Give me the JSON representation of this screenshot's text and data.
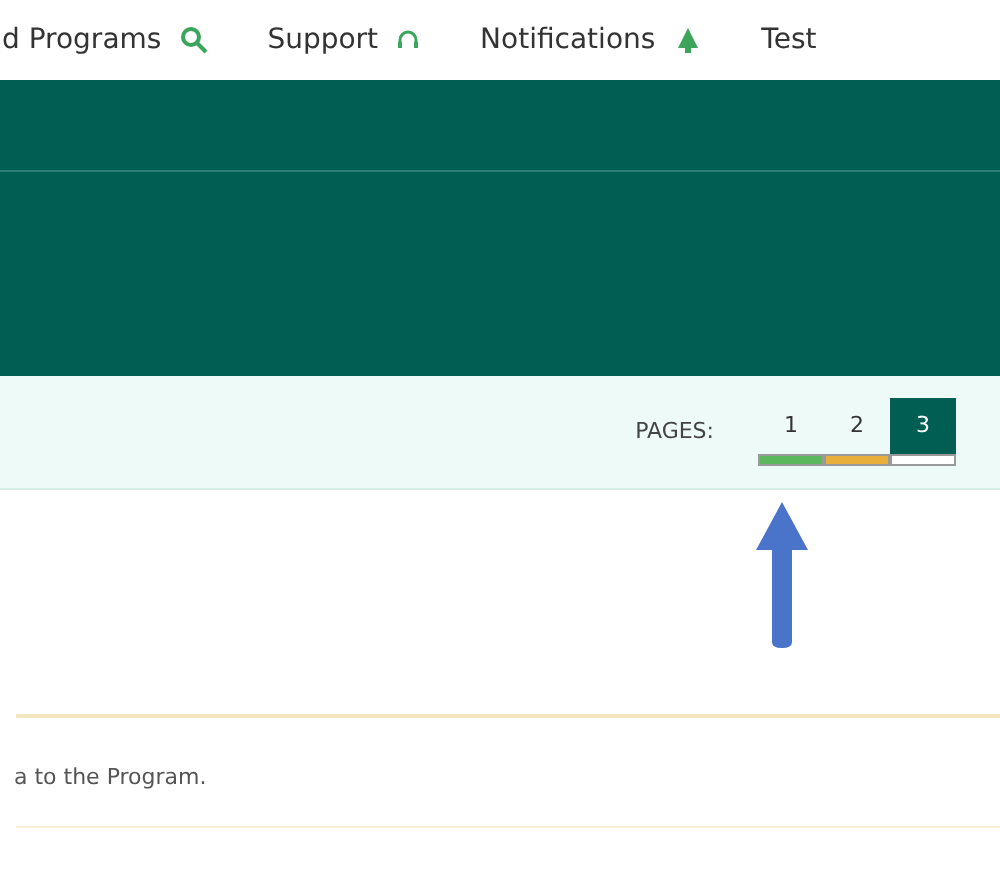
{
  "nav": [
    {
      "label": "d Programs",
      "kind": "search"
    },
    {
      "label": "Support",
      "kind": "support"
    },
    {
      "label": "Notifications",
      "kind": "alerts"
    },
    {
      "label": "Test",
      "kind": "plain"
    }
  ],
  "pagination": {
    "label": "PAGES:",
    "pages": [
      {
        "label": "1",
        "selected": false,
        "color": "#5cb85c"
      },
      {
        "label": "2",
        "selected": false,
        "color": "#e8b03a"
      },
      {
        "label": "3",
        "selected": true,
        "color": "#ffffff"
      }
    ]
  },
  "body_text": "a to the Program."
}
